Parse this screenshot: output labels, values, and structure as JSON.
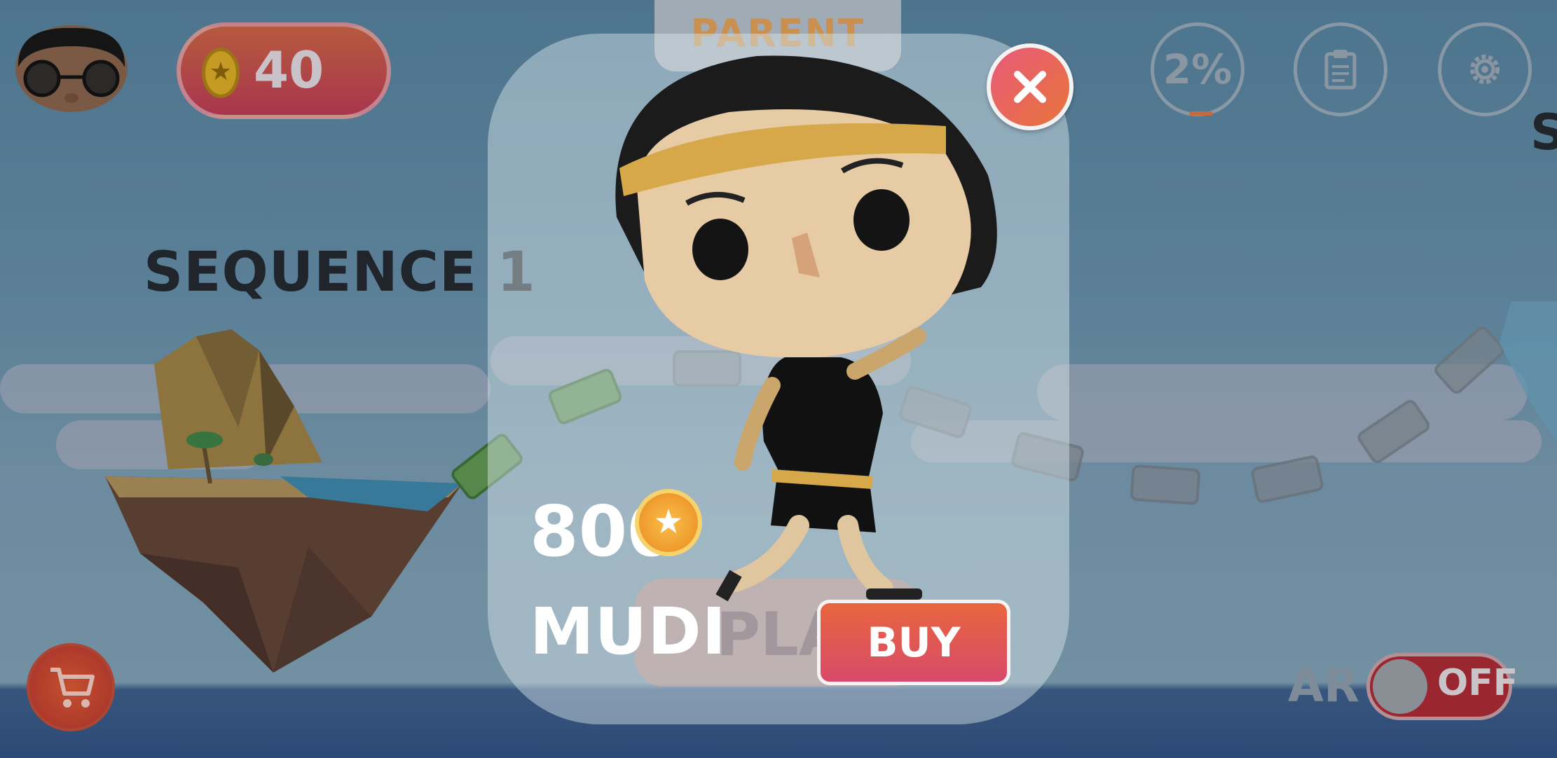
{
  "hud": {
    "coin_balance": "40",
    "parent_label": "PARENT",
    "progress_label": "2%"
  },
  "map": {
    "sequence_title": "SEQUENCE 1",
    "next_sequence_partial": "S"
  },
  "ar": {
    "label": "AR",
    "state": "OFF"
  },
  "popup": {
    "price": "800",
    "character_name": "MUDI",
    "play_label": "PLAY",
    "buy_label": "BUY"
  },
  "icons": {
    "coin": "coin-icon",
    "close": "close-icon",
    "tasks": "clipboard-icon",
    "settings": "gear-icon",
    "cart": "cart-icon"
  },
  "colors": {
    "buy_button": "#e06050",
    "close_button": "#e8743a",
    "toggle_off": "#9a2630",
    "coin_gold": "#f5a623"
  }
}
